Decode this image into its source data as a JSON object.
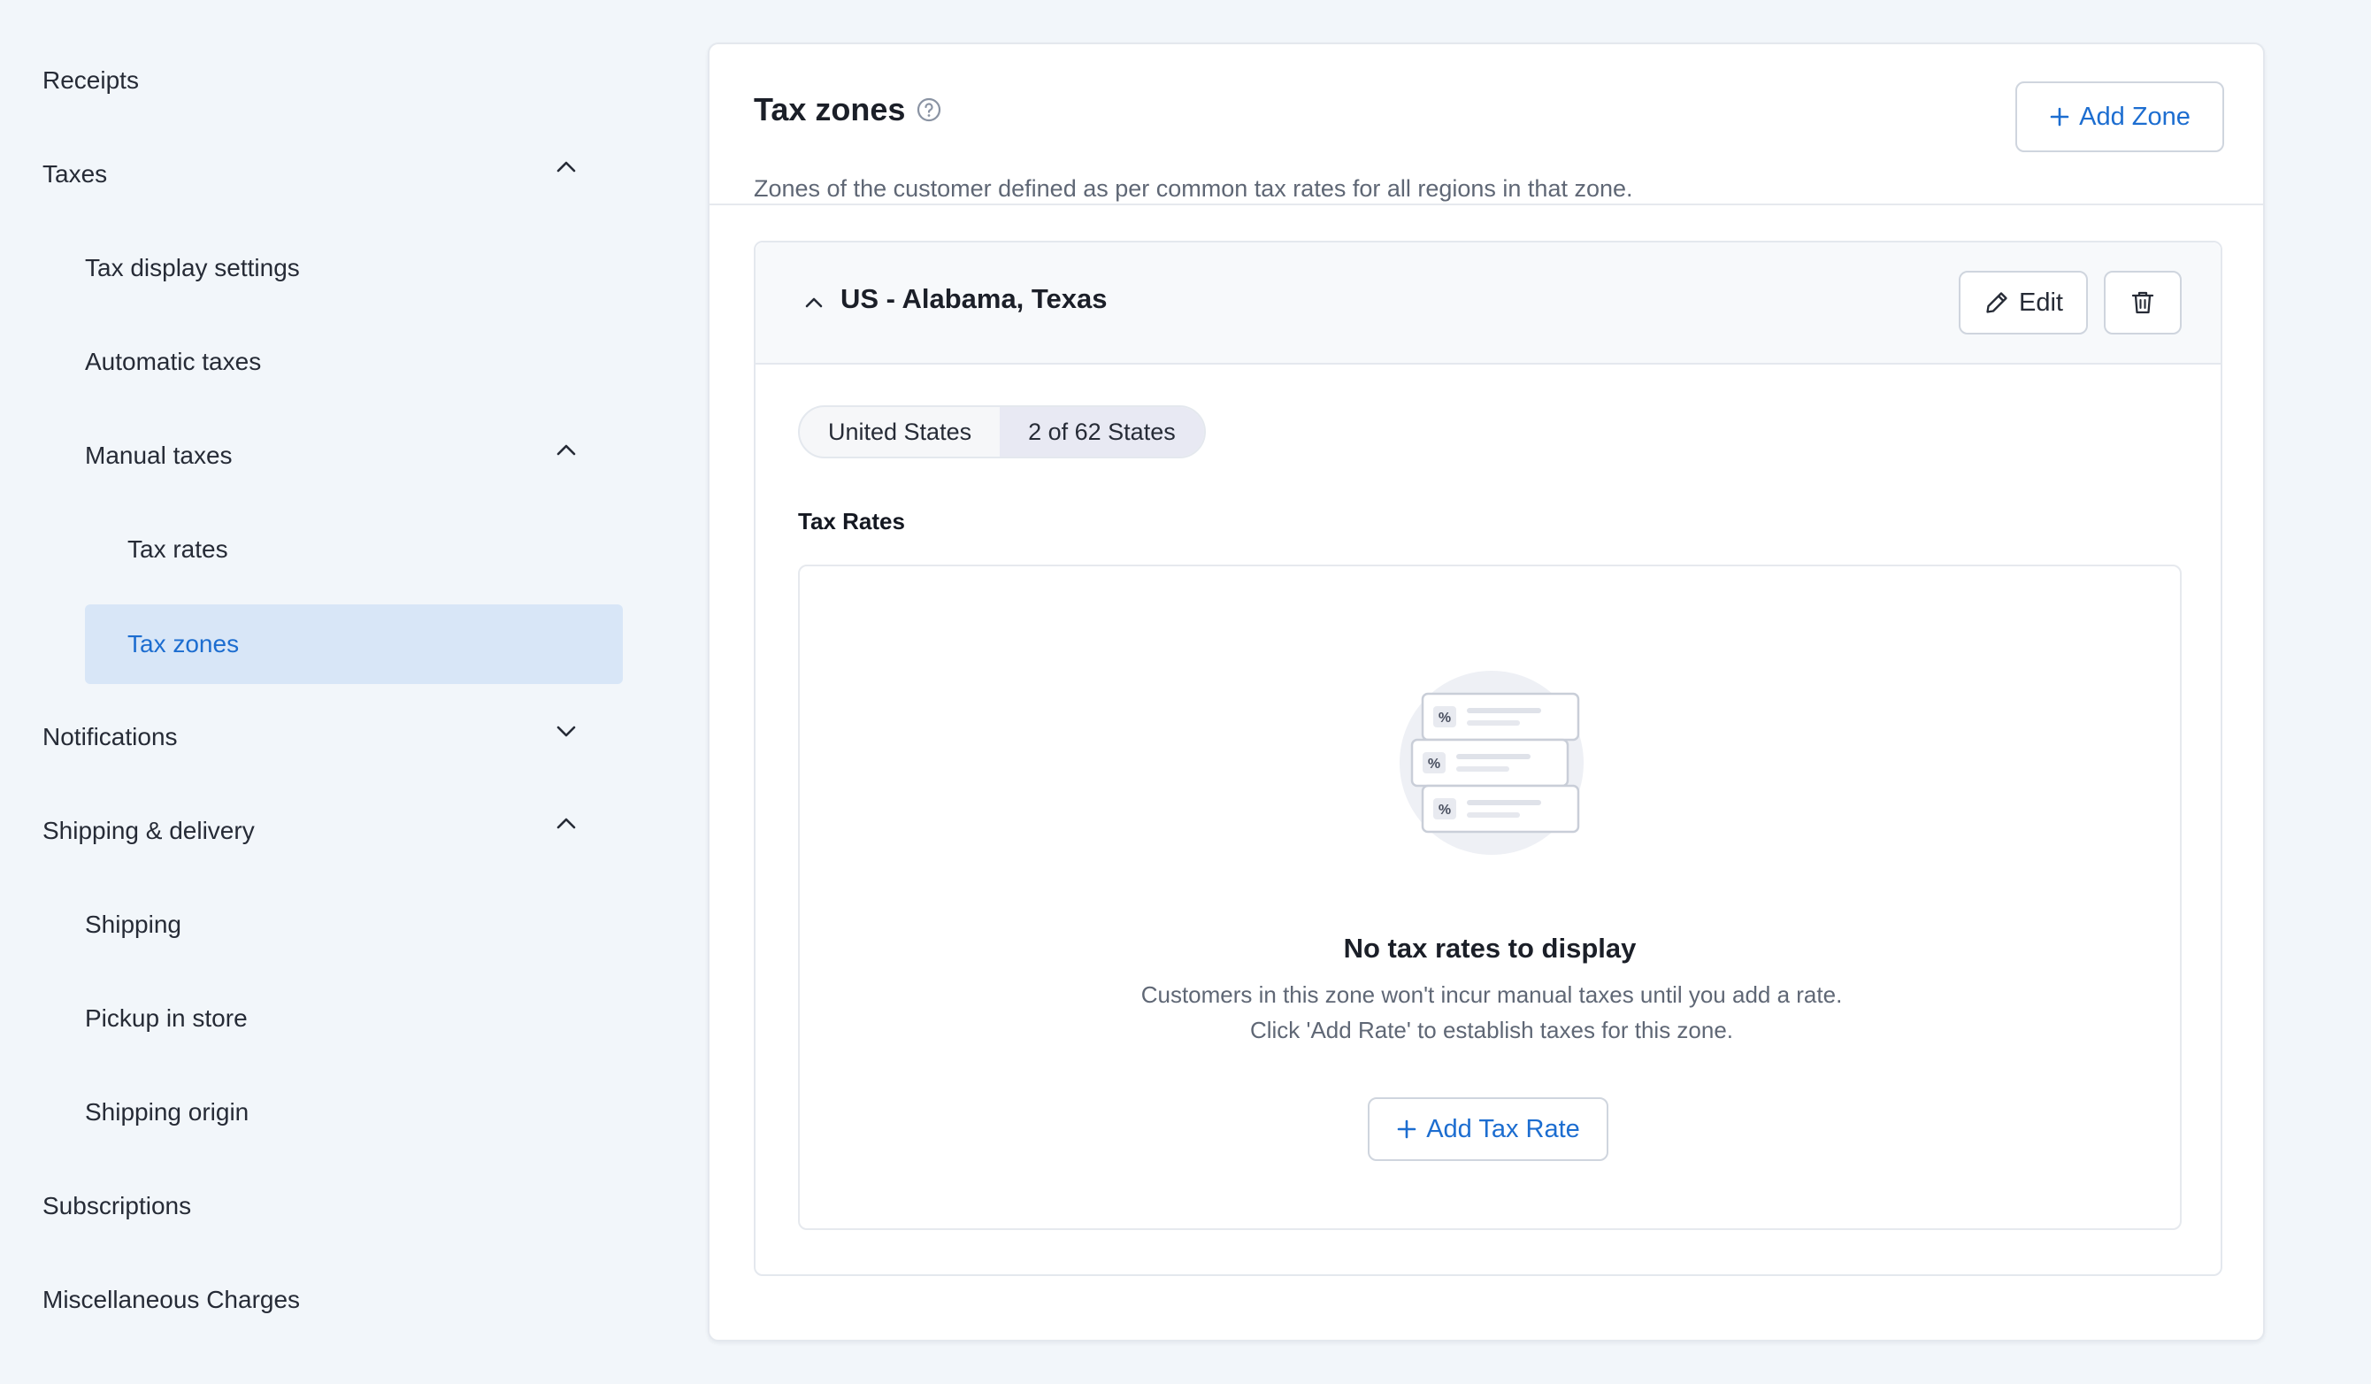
{
  "sidebar": {
    "items": [
      {
        "label": "Receipts"
      },
      {
        "label": "Taxes"
      },
      {
        "label": "Tax display settings"
      },
      {
        "label": "Automatic taxes"
      },
      {
        "label": "Manual taxes"
      },
      {
        "label": "Tax rates"
      },
      {
        "label": "Tax zones"
      },
      {
        "label": "Notifications"
      },
      {
        "label": "Shipping & delivery"
      },
      {
        "label": "Shipping"
      },
      {
        "label": "Pickup in store"
      },
      {
        "label": "Shipping origin"
      },
      {
        "label": "Subscriptions"
      },
      {
        "label": "Miscellaneous Charges"
      }
    ],
    "active_item": "Tax zones"
  },
  "header": {
    "title": "Tax zones",
    "subtitle": "Zones of the customer defined as per common tax rates for all regions in that zone.",
    "add_zone_label": "Add Zone"
  },
  "zone": {
    "title": "US - Alabama, Texas",
    "edit_label": "Edit",
    "country": "United States",
    "states": "2 of 62 States",
    "tax_rates_label": "Tax Rates",
    "empty_title": "No tax rates to display",
    "empty_desc": "Customers in this zone won't incur manual taxes until you add a rate. Click 'Add Rate' to establish taxes for this zone.",
    "add_rate_label": "Add Tax Rate",
    "illustration_symbol": "%"
  },
  "colors": {
    "accent": "#1c6dd0",
    "active_bg": "#d8e6f7",
    "page_bg": "#f2f6fa"
  }
}
